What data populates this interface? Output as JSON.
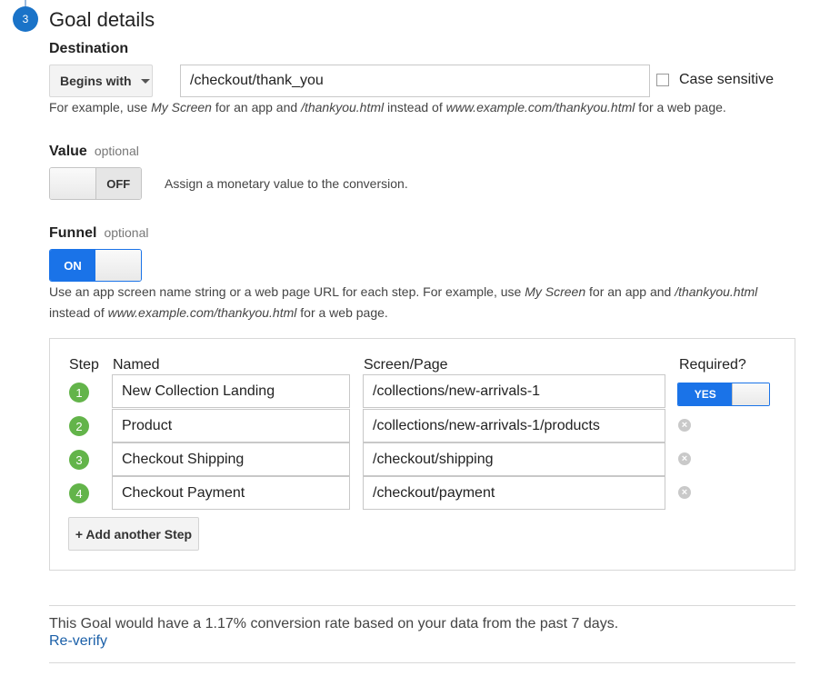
{
  "step_number": "3",
  "title": "Goal details",
  "destination": {
    "label": "Destination",
    "match_type": "Begins with",
    "value": "/checkout/thank_you",
    "case_sensitive_label": "Case sensitive",
    "help_parts": [
      "For example, use ",
      "My Screen",
      " for an app and ",
      "/thankyou.html",
      " instead of ",
      "www.example.com/thankyou.html",
      " for a web page."
    ]
  },
  "value_section": {
    "label": "Value",
    "optional": "optional",
    "toggle_state": "OFF",
    "description": "Assign a monetary value to the conversion."
  },
  "funnel": {
    "label": "Funnel",
    "optional": "optional",
    "toggle_state": "ON",
    "help_line1_parts": [
      "Use an app screen name string or a web page URL for each step. For example, use ",
      "My Screen",
      " for an app and ",
      "/thankyou.html"
    ],
    "help_line2_parts": [
      "instead of ",
      "www.example.com/thankyou.html",
      " for a web page."
    ],
    "headers": {
      "step": "Step",
      "named": "Named",
      "page": "Screen/Page",
      "required": "Required?"
    },
    "steps": [
      {
        "num": "1",
        "name": "New Collection Landing",
        "page": "/collections/new-arrivals-1",
        "required": "YES"
      },
      {
        "num": "2",
        "name": "Product",
        "page": "/collections/new-arrivals-1/products"
      },
      {
        "num": "3",
        "name": "Checkout Shipping",
        "page": "/checkout/shipping"
      },
      {
        "num": "4",
        "name": "Checkout Payment",
        "page": "/checkout/payment"
      }
    ],
    "remove_icon": "×",
    "add_step_label": "+ Add another Step"
  },
  "conversion_text": "This Goal would have a 1.17% conversion rate based on your data from the past 7 days.",
  "reverify_label": "Re-verify",
  "colors": {
    "accent": "#1a73e8",
    "step_green": "#63b44a",
    "link": "#1a5fa8"
  }
}
